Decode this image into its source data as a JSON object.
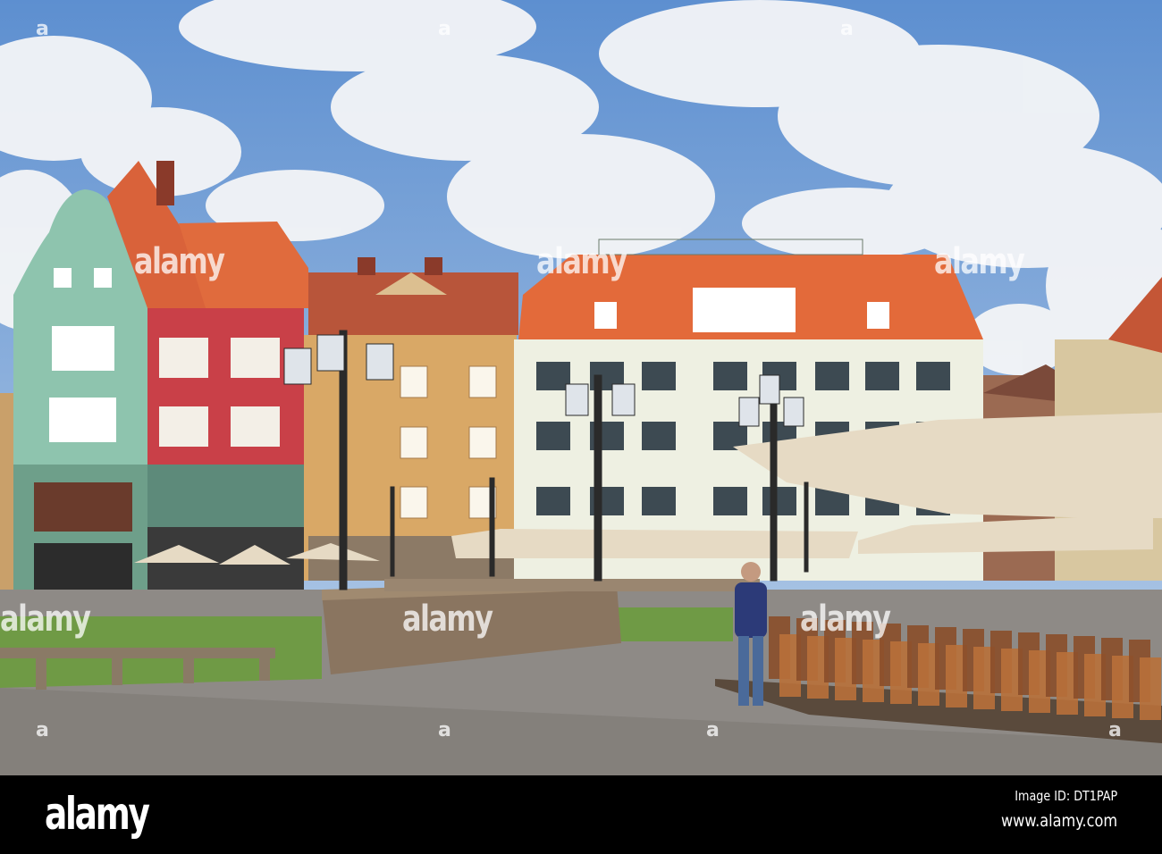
{
  "watermark": {
    "small_mark": "a",
    "word_mark": "alamy"
  },
  "footer": {
    "logo": "alamy",
    "image_id": "Image ID: DT1PAP",
    "url": "www.alamy.com"
  },
  "colors": {
    "sky": "#6f9fd8",
    "green_building": "#8ec4ae",
    "red_building": "#c94048",
    "yellow_building": "#d9a866",
    "white_building": "#eef0e2",
    "roof": "#e36a3a",
    "lawn": "#6f9a45",
    "cobble": "#8e8a86",
    "canopy": "#e6dac4"
  }
}
